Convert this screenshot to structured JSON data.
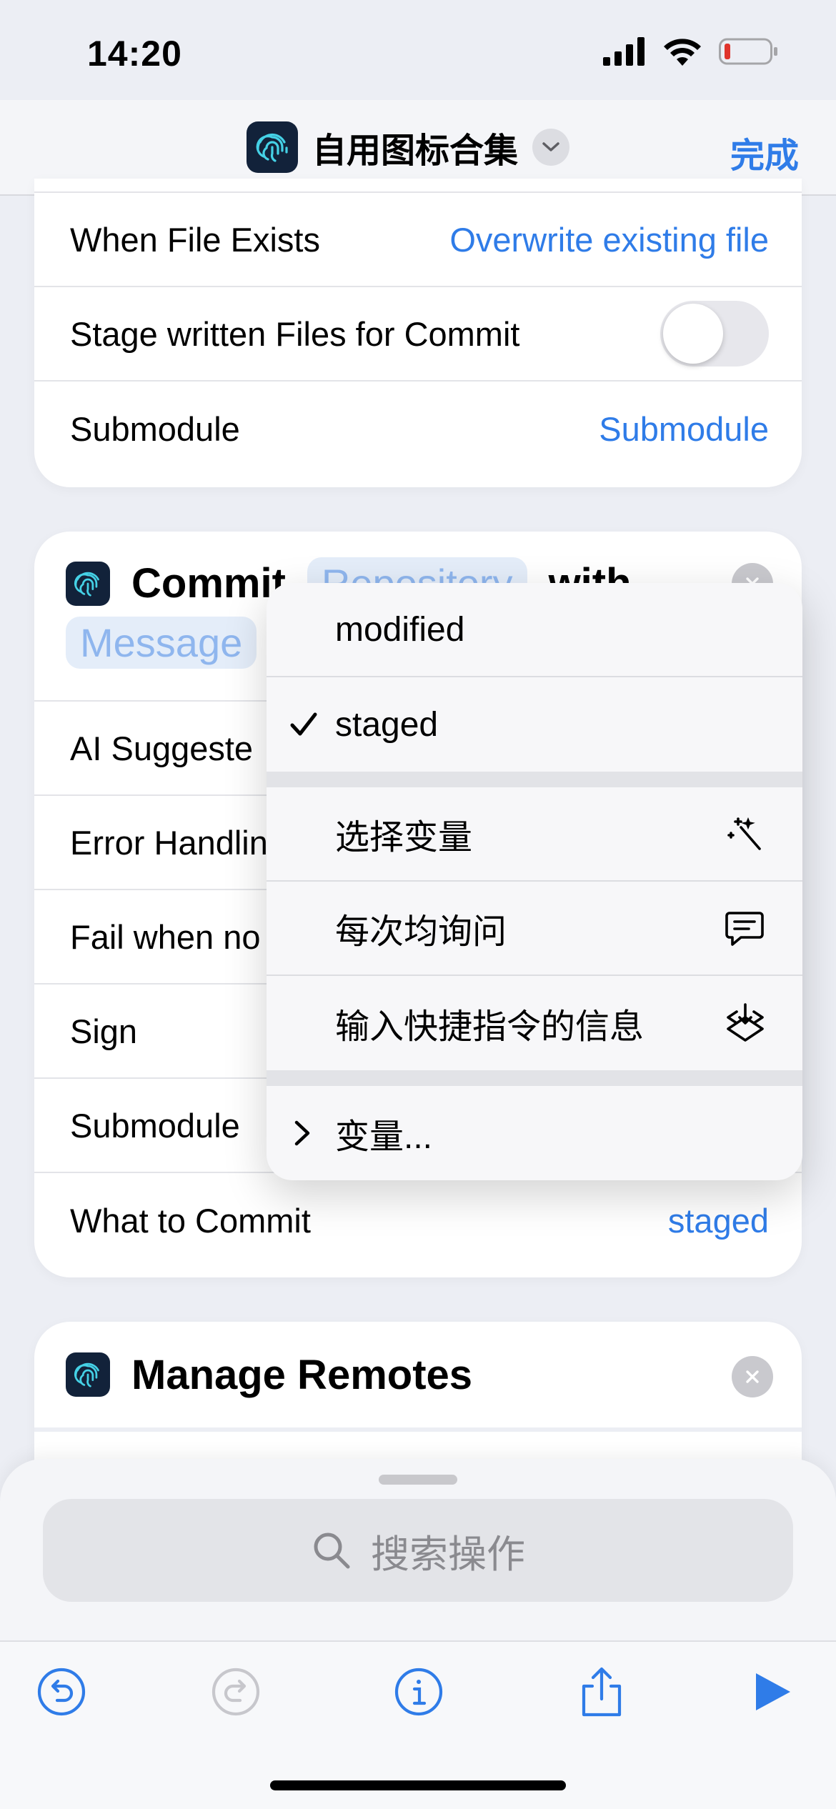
{
  "status": {
    "time": "14:20"
  },
  "nav": {
    "title": "自用图标合集",
    "done": "完成"
  },
  "card1": {
    "rows": [
      {
        "label": "When File Exists",
        "value": "Overwrite existing file"
      },
      {
        "label": "Stage written Files for Commit"
      },
      {
        "label": "Submodule",
        "value": "Submodule"
      }
    ]
  },
  "card2": {
    "title": "Commit",
    "repo_pill": "Repository",
    "with": "with",
    "message_pill": "Message",
    "rows": [
      {
        "label": "AI Suggeste"
      },
      {
        "label": "Error Handlin"
      },
      {
        "label": "Fail when no"
      },
      {
        "label": "Sign"
      },
      {
        "label": "Submodule"
      },
      {
        "label": "What to Commit",
        "value": "staged"
      }
    ]
  },
  "card3": {
    "title": "Manage Remotes"
  },
  "menu": {
    "items": [
      {
        "label": "modified"
      },
      {
        "label": "staged",
        "checked": true
      },
      {
        "label": "选择变量",
        "icon": "magic-wand-icon"
      },
      {
        "label": "每次均询问",
        "icon": "chat-bubble-icon"
      },
      {
        "label": "输入快捷指令的信息",
        "icon": "shortcut-input-icon"
      },
      {
        "label": "变量...",
        "icon": "chevron-right-icon"
      }
    ]
  },
  "search": {
    "placeholder": "搜索操作"
  },
  "colors": {
    "accent": "#2f7ce8",
    "run": "#2f7ce8"
  }
}
